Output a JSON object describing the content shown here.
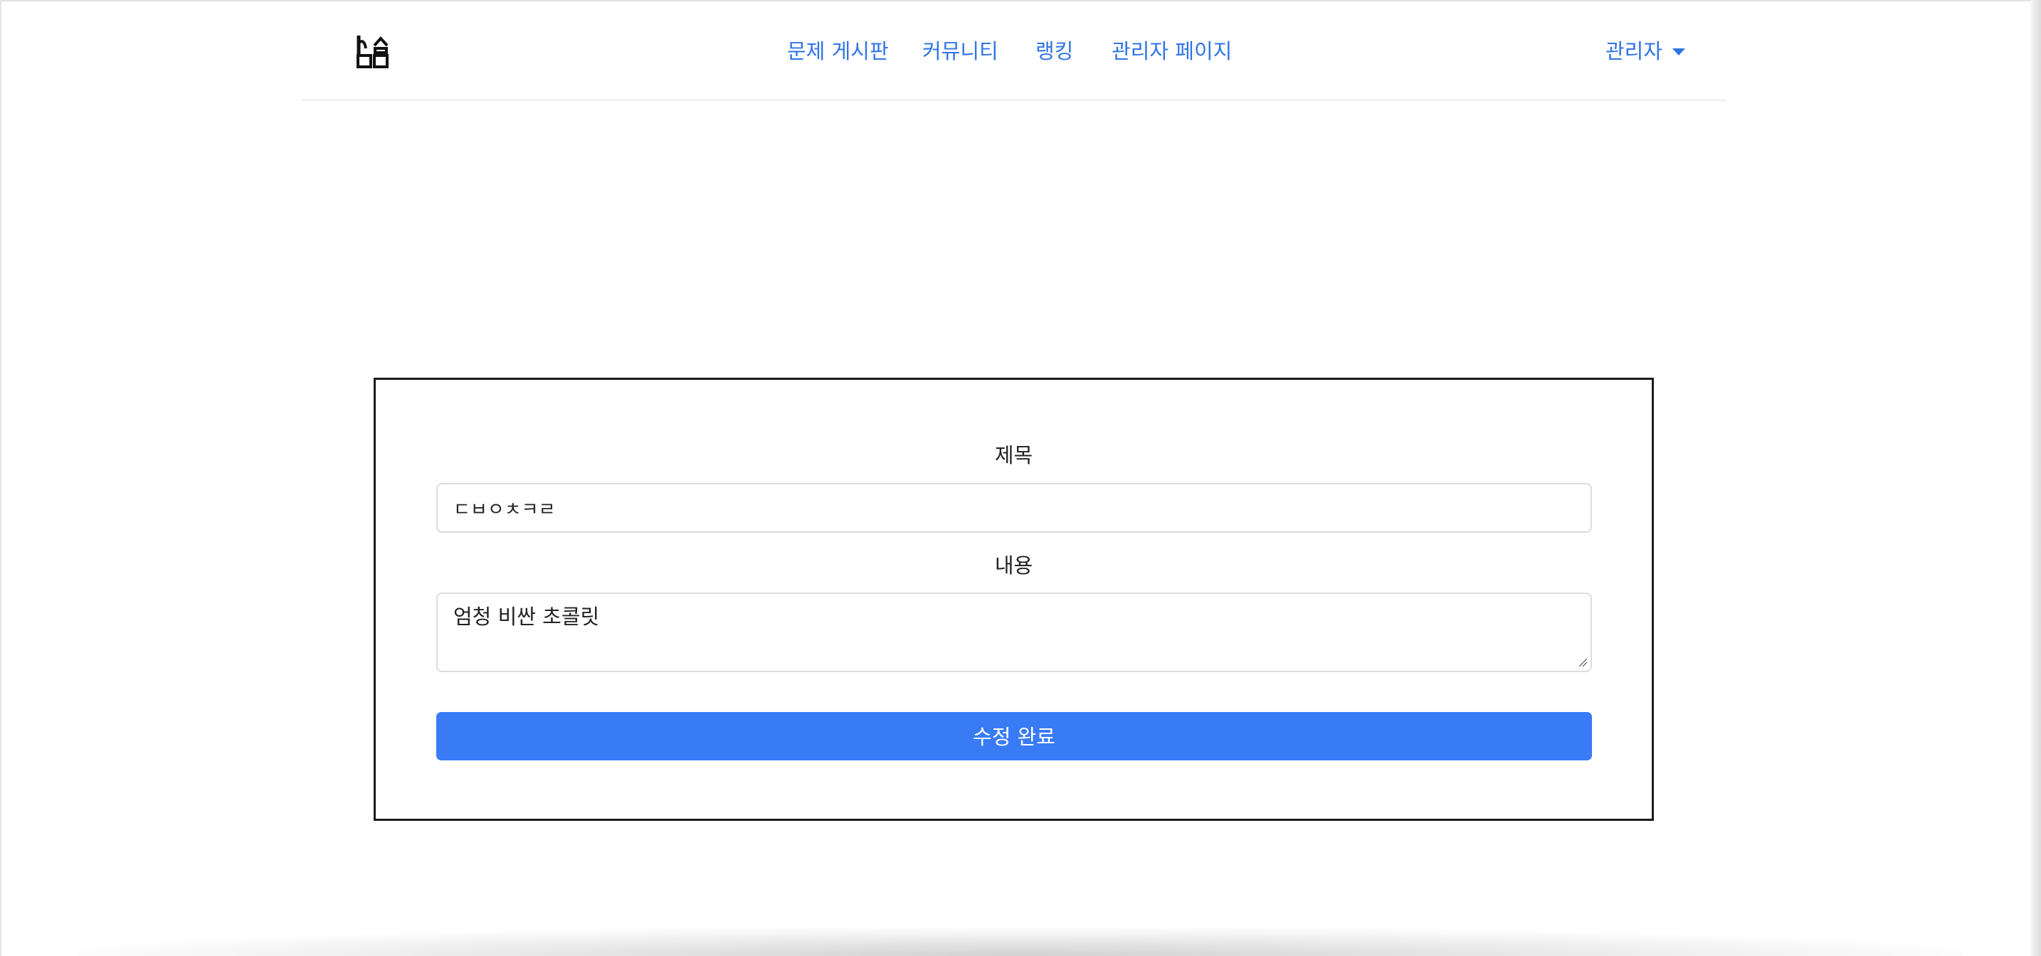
{
  "navbar": {
    "brand_icon": "house-logo-icon",
    "links": [
      {
        "label": "문제 게시판"
      },
      {
        "label": "커뮤니티"
      },
      {
        "label": "랭킹"
      },
      {
        "label": "관리자 페이지"
      }
    ],
    "user_menu": {
      "label": "관리자",
      "icon": "caret-down-icon"
    }
  },
  "form": {
    "title_label": "제목",
    "title_value": "ㄷㅂㅇㅊㅋㄹ",
    "content_label": "내용",
    "content_value": "엄청 비싼 초콜릿",
    "submit_label": "수정 완료"
  },
  "colors": {
    "link": "#2f74e6",
    "button": "#387bf5",
    "card_border": "#1b1b1b"
  }
}
